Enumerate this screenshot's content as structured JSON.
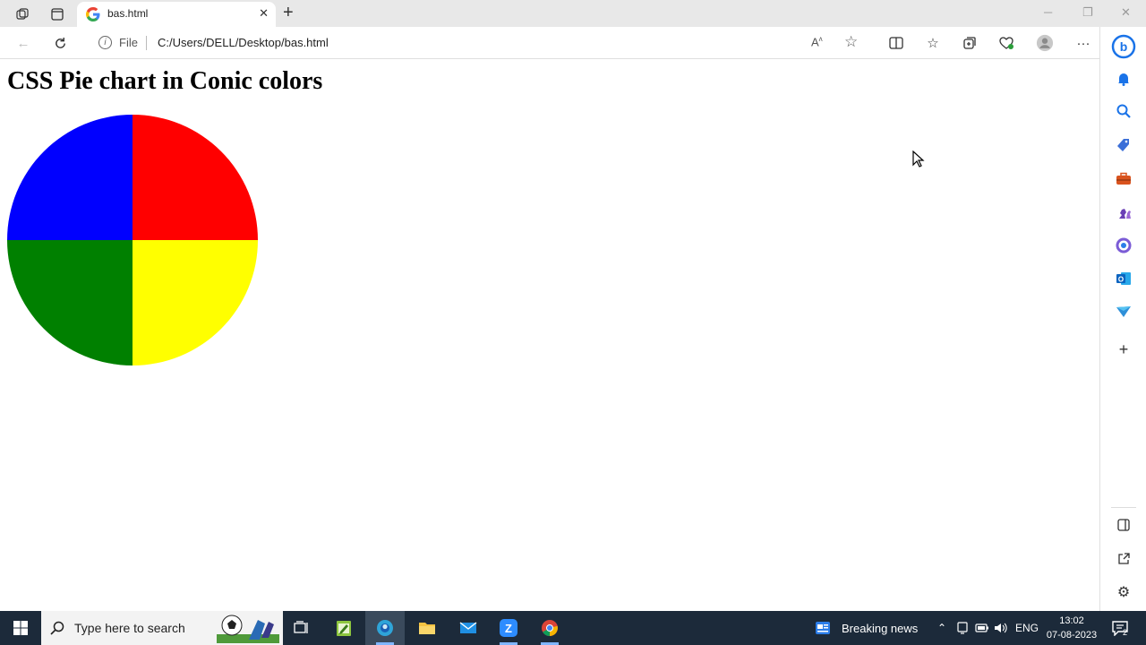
{
  "browser": {
    "tab": {
      "title": "bas.html"
    },
    "address": {
      "scheme_label": "File",
      "url": "C:/Users/DELL/Desktop/bas.html"
    }
  },
  "page": {
    "heading": "CSS Pie chart in Conic colors"
  },
  "chart_data": {
    "type": "pie",
    "title": "",
    "slices": [
      {
        "color": "#ff0000",
        "value": 25,
        "start_deg": 0,
        "end_deg": 90
      },
      {
        "color": "#ffff00",
        "value": 25,
        "start_deg": 90,
        "end_deg": 180
      },
      {
        "color": "#008000",
        "value": 25,
        "start_deg": 180,
        "end_deg": 270
      },
      {
        "color": "#0000ff",
        "value": 25,
        "start_deg": 270,
        "end_deg": 360
      }
    ]
  },
  "taskbar": {
    "search_placeholder": "Type here to search",
    "news_label": "Breaking news",
    "language": "ENG",
    "time": "13:02",
    "date": "07-08-2023",
    "notification_count": "2"
  },
  "colors": {
    "taskbar_bg": "#1c2a3a",
    "accent": "#0a66c2"
  }
}
